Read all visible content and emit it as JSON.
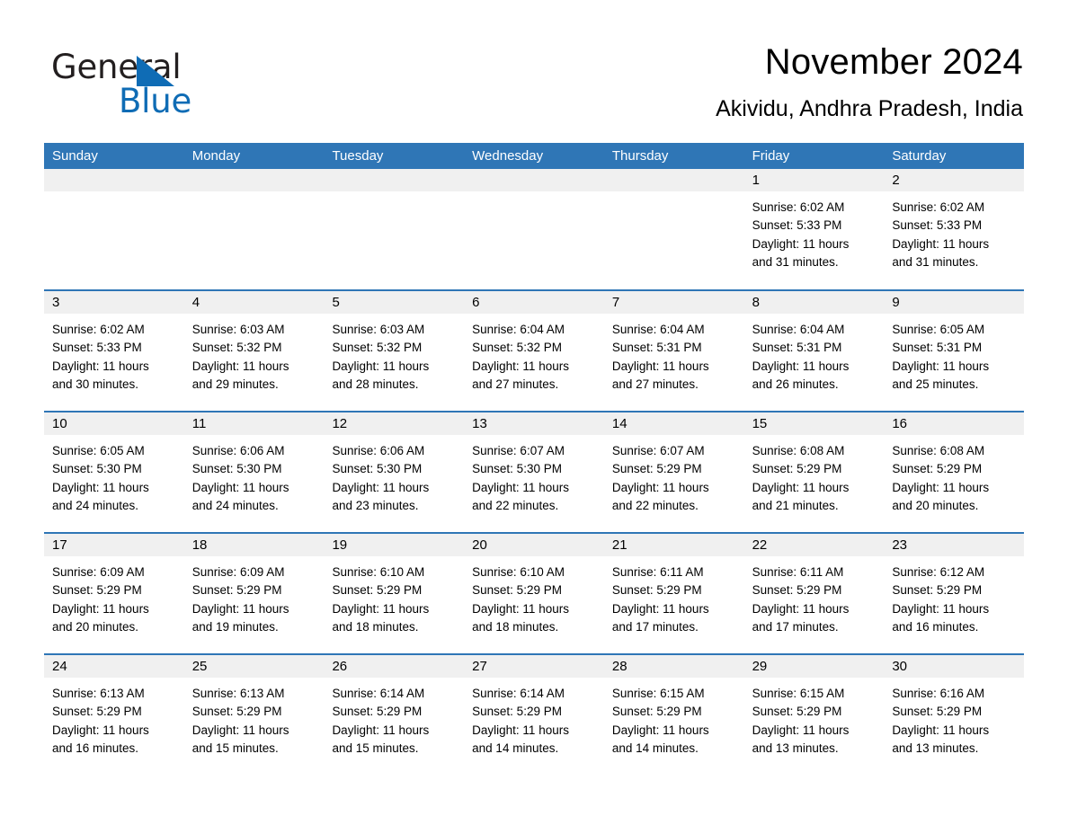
{
  "logo": {
    "word1": "General",
    "word2": "Blue",
    "triangle_color": "#0f6cb5"
  },
  "header": {
    "title": "November 2024",
    "subtitle": "Akividu, Andhra Pradesh, India"
  },
  "colors": {
    "header_blue": "#2f76b6",
    "day_band_gray": "#f0f0f0",
    "text": "#000000"
  },
  "calendar": {
    "weekdays": [
      "Sunday",
      "Monday",
      "Tuesday",
      "Wednesday",
      "Thursday",
      "Friday",
      "Saturday"
    ],
    "weeks": [
      [
        {
          "day": "",
          "sunrise": "",
          "sunset": "",
          "daylight1": "",
          "daylight2": ""
        },
        {
          "day": "",
          "sunrise": "",
          "sunset": "",
          "daylight1": "",
          "daylight2": ""
        },
        {
          "day": "",
          "sunrise": "",
          "sunset": "",
          "daylight1": "",
          "daylight2": ""
        },
        {
          "day": "",
          "sunrise": "",
          "sunset": "",
          "daylight1": "",
          "daylight2": ""
        },
        {
          "day": "",
          "sunrise": "",
          "sunset": "",
          "daylight1": "",
          "daylight2": ""
        },
        {
          "day": "1",
          "sunrise": "Sunrise: 6:02 AM",
          "sunset": "Sunset: 5:33 PM",
          "daylight1": "Daylight: 11 hours",
          "daylight2": "and 31 minutes."
        },
        {
          "day": "2",
          "sunrise": "Sunrise: 6:02 AM",
          "sunset": "Sunset: 5:33 PM",
          "daylight1": "Daylight: 11 hours",
          "daylight2": "and 31 minutes."
        }
      ],
      [
        {
          "day": "3",
          "sunrise": "Sunrise: 6:02 AM",
          "sunset": "Sunset: 5:33 PM",
          "daylight1": "Daylight: 11 hours",
          "daylight2": "and 30 minutes."
        },
        {
          "day": "4",
          "sunrise": "Sunrise: 6:03 AM",
          "sunset": "Sunset: 5:32 PM",
          "daylight1": "Daylight: 11 hours",
          "daylight2": "and 29 minutes."
        },
        {
          "day": "5",
          "sunrise": "Sunrise: 6:03 AM",
          "sunset": "Sunset: 5:32 PM",
          "daylight1": "Daylight: 11 hours",
          "daylight2": "and 28 minutes."
        },
        {
          "day": "6",
          "sunrise": "Sunrise: 6:04 AM",
          "sunset": "Sunset: 5:32 PM",
          "daylight1": "Daylight: 11 hours",
          "daylight2": "and 27 minutes."
        },
        {
          "day": "7",
          "sunrise": "Sunrise: 6:04 AM",
          "sunset": "Sunset: 5:31 PM",
          "daylight1": "Daylight: 11 hours",
          "daylight2": "and 27 minutes."
        },
        {
          "day": "8",
          "sunrise": "Sunrise: 6:04 AM",
          "sunset": "Sunset: 5:31 PM",
          "daylight1": "Daylight: 11 hours",
          "daylight2": "and 26 minutes."
        },
        {
          "day": "9",
          "sunrise": "Sunrise: 6:05 AM",
          "sunset": "Sunset: 5:31 PM",
          "daylight1": "Daylight: 11 hours",
          "daylight2": "and 25 minutes."
        }
      ],
      [
        {
          "day": "10",
          "sunrise": "Sunrise: 6:05 AM",
          "sunset": "Sunset: 5:30 PM",
          "daylight1": "Daylight: 11 hours",
          "daylight2": "and 24 minutes."
        },
        {
          "day": "11",
          "sunrise": "Sunrise: 6:06 AM",
          "sunset": "Sunset: 5:30 PM",
          "daylight1": "Daylight: 11 hours",
          "daylight2": "and 24 minutes."
        },
        {
          "day": "12",
          "sunrise": "Sunrise: 6:06 AM",
          "sunset": "Sunset: 5:30 PM",
          "daylight1": "Daylight: 11 hours",
          "daylight2": "and 23 minutes."
        },
        {
          "day": "13",
          "sunrise": "Sunrise: 6:07 AM",
          "sunset": "Sunset: 5:30 PM",
          "daylight1": "Daylight: 11 hours",
          "daylight2": "and 22 minutes."
        },
        {
          "day": "14",
          "sunrise": "Sunrise: 6:07 AM",
          "sunset": "Sunset: 5:29 PM",
          "daylight1": "Daylight: 11 hours",
          "daylight2": "and 22 minutes."
        },
        {
          "day": "15",
          "sunrise": "Sunrise: 6:08 AM",
          "sunset": "Sunset: 5:29 PM",
          "daylight1": "Daylight: 11 hours",
          "daylight2": "and 21 minutes."
        },
        {
          "day": "16",
          "sunrise": "Sunrise: 6:08 AM",
          "sunset": "Sunset: 5:29 PM",
          "daylight1": "Daylight: 11 hours",
          "daylight2": "and 20 minutes."
        }
      ],
      [
        {
          "day": "17",
          "sunrise": "Sunrise: 6:09 AM",
          "sunset": "Sunset: 5:29 PM",
          "daylight1": "Daylight: 11 hours",
          "daylight2": "and 20 minutes."
        },
        {
          "day": "18",
          "sunrise": "Sunrise: 6:09 AM",
          "sunset": "Sunset: 5:29 PM",
          "daylight1": "Daylight: 11 hours",
          "daylight2": "and 19 minutes."
        },
        {
          "day": "19",
          "sunrise": "Sunrise: 6:10 AM",
          "sunset": "Sunset: 5:29 PM",
          "daylight1": "Daylight: 11 hours",
          "daylight2": "and 18 minutes."
        },
        {
          "day": "20",
          "sunrise": "Sunrise: 6:10 AM",
          "sunset": "Sunset: 5:29 PM",
          "daylight1": "Daylight: 11 hours",
          "daylight2": "and 18 minutes."
        },
        {
          "day": "21",
          "sunrise": "Sunrise: 6:11 AM",
          "sunset": "Sunset: 5:29 PM",
          "daylight1": "Daylight: 11 hours",
          "daylight2": "and 17 minutes."
        },
        {
          "day": "22",
          "sunrise": "Sunrise: 6:11 AM",
          "sunset": "Sunset: 5:29 PM",
          "daylight1": "Daylight: 11 hours",
          "daylight2": "and 17 minutes."
        },
        {
          "day": "23",
          "sunrise": "Sunrise: 6:12 AM",
          "sunset": "Sunset: 5:29 PM",
          "daylight1": "Daylight: 11 hours",
          "daylight2": "and 16 minutes."
        }
      ],
      [
        {
          "day": "24",
          "sunrise": "Sunrise: 6:13 AM",
          "sunset": "Sunset: 5:29 PM",
          "daylight1": "Daylight: 11 hours",
          "daylight2": "and 16 minutes."
        },
        {
          "day": "25",
          "sunrise": "Sunrise: 6:13 AM",
          "sunset": "Sunset: 5:29 PM",
          "daylight1": "Daylight: 11 hours",
          "daylight2": "and 15 minutes."
        },
        {
          "day": "26",
          "sunrise": "Sunrise: 6:14 AM",
          "sunset": "Sunset: 5:29 PM",
          "daylight1": "Daylight: 11 hours",
          "daylight2": "and 15 minutes."
        },
        {
          "day": "27",
          "sunrise": "Sunrise: 6:14 AM",
          "sunset": "Sunset: 5:29 PM",
          "daylight1": "Daylight: 11 hours",
          "daylight2": "and 14 minutes."
        },
        {
          "day": "28",
          "sunrise": "Sunrise: 6:15 AM",
          "sunset": "Sunset: 5:29 PM",
          "daylight1": "Daylight: 11 hours",
          "daylight2": "and 14 minutes."
        },
        {
          "day": "29",
          "sunrise": "Sunrise: 6:15 AM",
          "sunset": "Sunset: 5:29 PM",
          "daylight1": "Daylight: 11 hours",
          "daylight2": "and 13 minutes."
        },
        {
          "day": "30",
          "sunrise": "Sunrise: 6:16 AM",
          "sunset": "Sunset: 5:29 PM",
          "daylight1": "Daylight: 11 hours",
          "daylight2": "and 13 minutes."
        }
      ]
    ]
  }
}
